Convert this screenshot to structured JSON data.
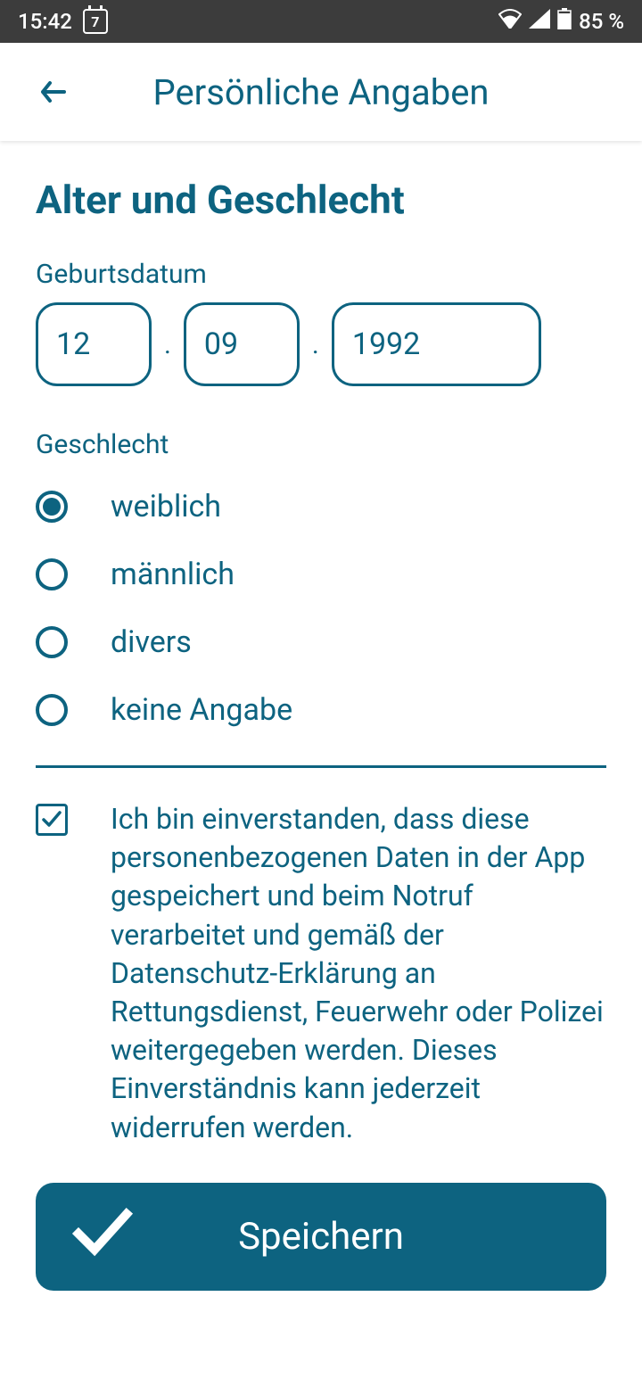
{
  "statusBar": {
    "time": "15:42",
    "calendarDay": "7",
    "battery": "85 %"
  },
  "appBar": {
    "title": "Persönliche Angaben"
  },
  "sectionTitle": "Alter und Geschlecht",
  "birthdate": {
    "label": "Geburtsdatum",
    "day": "12",
    "month": "09",
    "year": "1992",
    "separator": "."
  },
  "gender": {
    "label": "Geschlecht",
    "options": [
      {
        "label": "weiblich",
        "selected": true
      },
      {
        "label": "männlich",
        "selected": false
      },
      {
        "label": "divers",
        "selected": false
      },
      {
        "label": "keine Angabe",
        "selected": false
      }
    ]
  },
  "consent": {
    "checked": true,
    "text": "Ich bin einverstanden, dass diese personenbezogenen Daten in der App gespeichert und beim Notruf verarbeitet und gemäß der Datenschutz-Erklärung an Rettungsdienst, Feuerwehr oder Polizei weitergegeben werden. Dieses Einverständnis kann jederzeit widerrufen werden."
  },
  "saveButton": {
    "label": "Speichern"
  }
}
